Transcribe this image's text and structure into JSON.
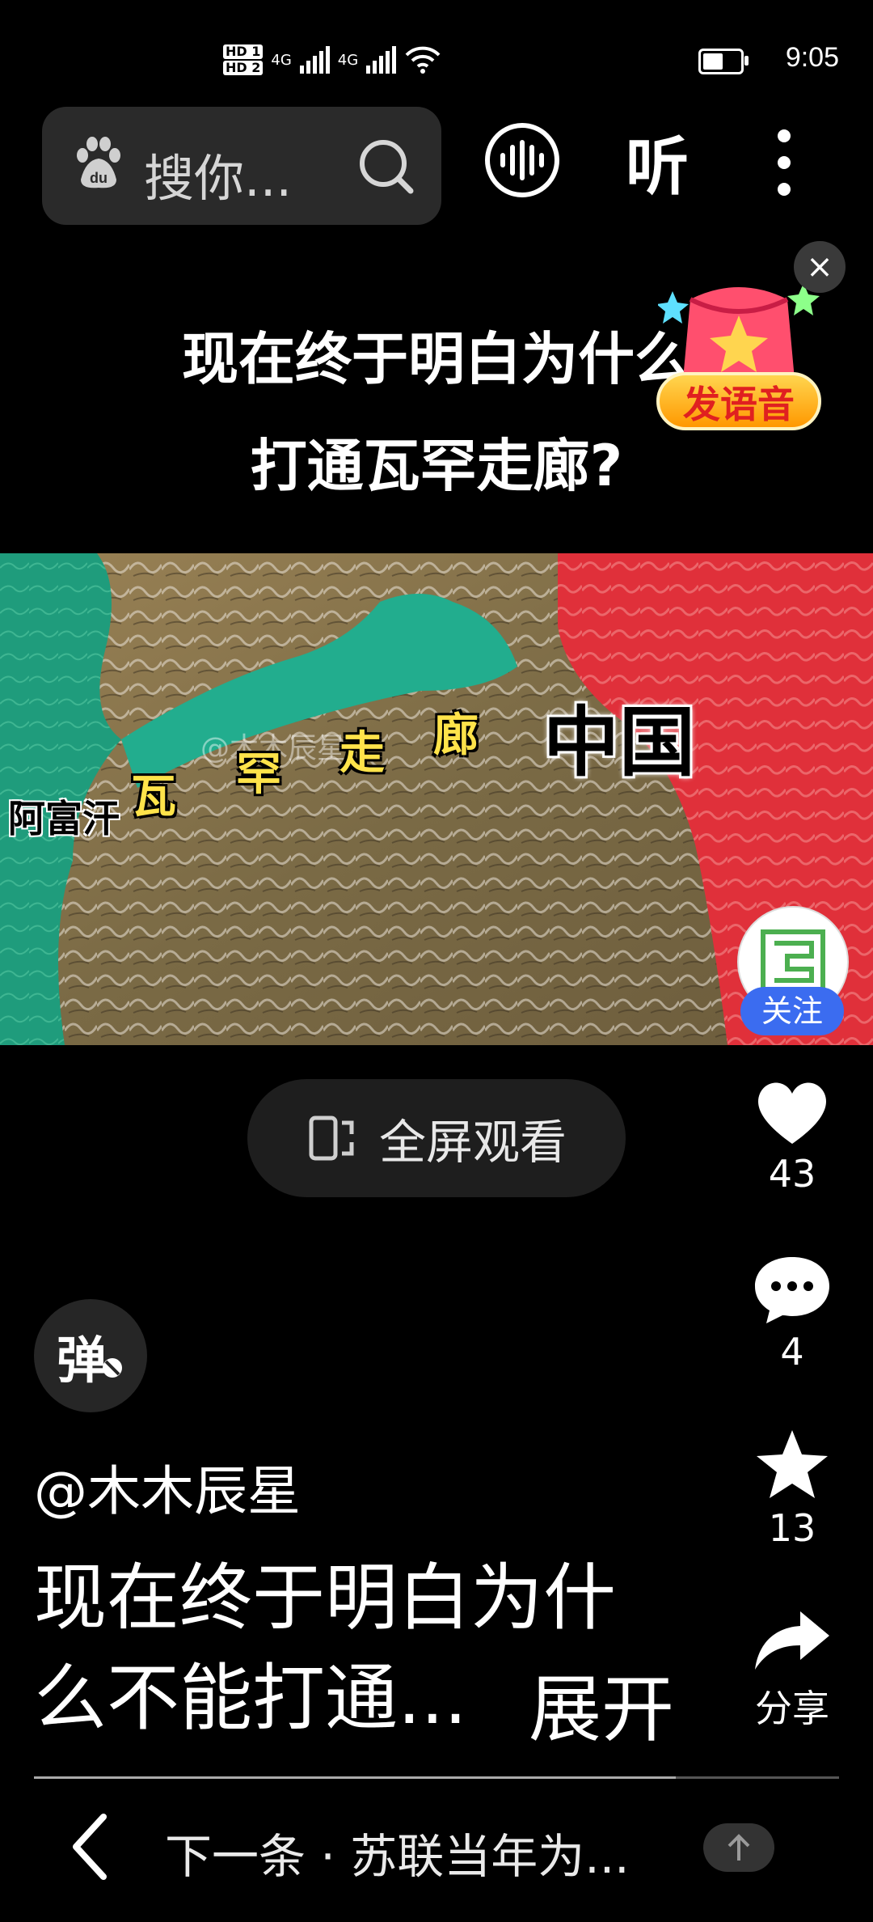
{
  "status_bar": {
    "time": "9:05",
    "sim1": "HD 1",
    "sim2": "HD 2",
    "net1": "4G",
    "net2": "4G"
  },
  "header": {
    "search_placeholder": "搜你...",
    "listen_label": "听"
  },
  "video": {
    "title_line1": "现在终于明白为什么",
    "title_line2": "打通瓦罕走廊?",
    "map_label_china": "中国",
    "map_label_afghanistan": "阿富汗",
    "corridor_chars": [
      "瓦",
      "罕",
      "走",
      "廊"
    ],
    "watermark": "@木木辰星"
  },
  "promo": {
    "label": "发语音",
    "close": "×"
  },
  "follow": {
    "label": "关注"
  },
  "fullscreen": {
    "label": "全屏观看"
  },
  "actions": {
    "likes": "43",
    "comments": "4",
    "favorites": "13",
    "share_label": "分享"
  },
  "danmaku": {
    "label": "弹"
  },
  "author": "@木木辰星",
  "description": {
    "line1": "现在终于明白为什",
    "line2": "么不能打通...",
    "expand_label": "展开"
  },
  "bottom": {
    "next_text": "下一条 · 苏联当年为..."
  },
  "colors": {
    "accent_blue": "#3b6cf0",
    "china_red": "#e0303a",
    "corridor_teal": "#1fa88c",
    "corridor_text": "#ffe34a"
  }
}
